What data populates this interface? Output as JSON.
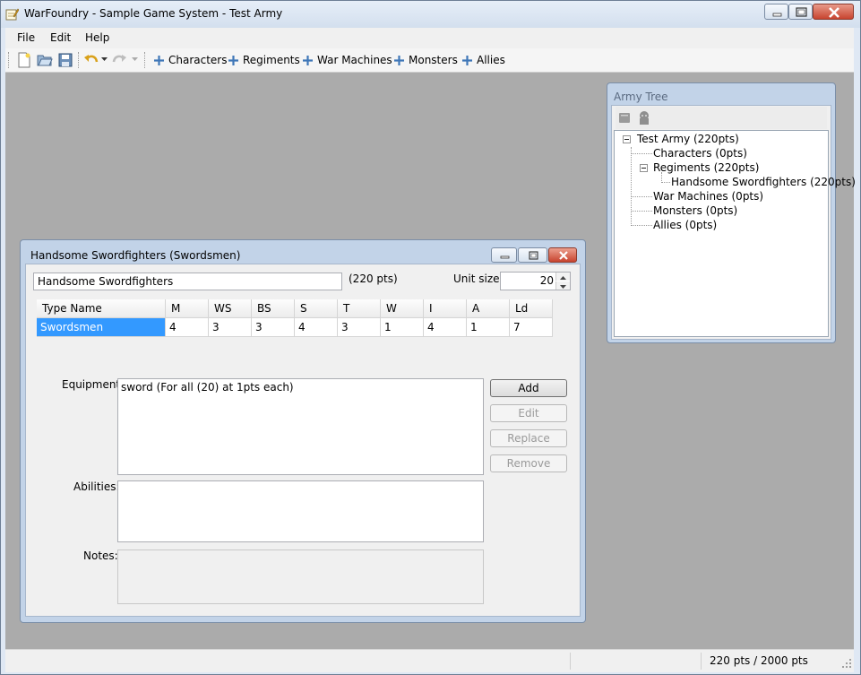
{
  "window": {
    "title": "WarFoundry - Sample Game System - Test Army",
    "icons": {
      "app": "notepad-pencil-icon",
      "minimize": "minimize-icon",
      "maximize": "maximize-icon",
      "close": "close-icon"
    }
  },
  "menu": {
    "items": [
      "File",
      "Edit",
      "Help"
    ]
  },
  "toolbar": {
    "icons": [
      "new-file-icon",
      "open-folder-icon",
      "save-icon",
      "undo-icon",
      "redo-icon"
    ],
    "add_buttons": [
      "Characters",
      "Regiments",
      "War Machines",
      "Monsters",
      "Allies"
    ]
  },
  "army_tree": {
    "title": "Army Tree",
    "tool_icons": [
      "edit-unit-icon",
      "remove-unit-icon"
    ],
    "root": "Test Army (220pts)",
    "nodes": {
      "characters": "Characters (0pts)",
      "regiments": "Regiments (220pts)",
      "unit": "Handsome Swordfighters (220pts)",
      "war_machines": "War Machines (0pts)",
      "monsters": "Monsters (0pts)",
      "allies": "Allies (0pts)"
    }
  },
  "unit_window": {
    "title": "Handsome Swordfighters (Swordsmen)",
    "name_value": "Handsome Swordfighters",
    "points": "(220 pts)",
    "unit_size_label": "Unit size:",
    "unit_size_value": "20",
    "stats": {
      "headers": [
        "Type Name",
        "M",
        "WS",
        "BS",
        "S",
        "T",
        "W",
        "I",
        "A",
        "Ld"
      ],
      "row": [
        "Swordsmen",
        "4",
        "3",
        "3",
        "4",
        "3",
        "1",
        "4",
        "1",
        "7"
      ]
    },
    "equipment_label": "Equipment:",
    "equipment_items": [
      "sword (For all (20) at 1pts each)"
    ],
    "abilities_label": "Abilities:",
    "notes_label": "Notes:",
    "buttons": {
      "add": "Add",
      "edit": "Edit",
      "replace": "Replace",
      "remove": "Remove"
    }
  },
  "status": {
    "points": "220 pts / 2000 pts"
  },
  "colors": {
    "selection": "#3399ff",
    "mdi_background": "#ababab",
    "title_frame": "#c2d3e8"
  }
}
